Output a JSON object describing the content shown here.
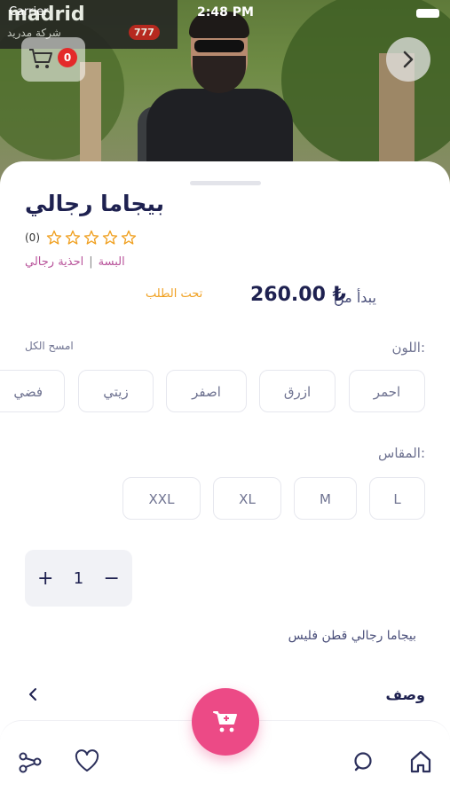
{
  "status_bar": {
    "carrier": "Carrier",
    "time": "2:48 PM"
  },
  "hero": {
    "sign_text": "madrid",
    "sign_sub": "شركة مدريد",
    "badge": "777"
  },
  "header": {
    "cart_count": "0"
  },
  "product": {
    "title": "بيجاما رجالي",
    "rating_count": "(0)",
    "stars": 0,
    "category_1": "البسة",
    "category_2": "احذية رجالي",
    "availability": "تحت الطلب",
    "price_prefix": "يبدأ من",
    "price": "260.00 ₺"
  },
  "color_section": {
    "label": "اللون:",
    "clear_all": "امسح الكل",
    "options": [
      "احمر",
      "ازرق",
      "اصفر",
      "زيتي",
      "فضي"
    ]
  },
  "size_section": {
    "label": "المقاس:",
    "options": [
      "L",
      "M",
      "XL",
      "XXL"
    ]
  },
  "quantity": {
    "plus": "+",
    "value": "1",
    "minus": "−"
  },
  "description_text": "بيجاما رجالي قطن فليس",
  "description_tab": "وصف",
  "colors": {
    "accent": "#ec4a86",
    "title": "#1e2150",
    "category": "#b8539a",
    "availability": "#f0a020",
    "cart_badge": "#e42a2a"
  },
  "icons": {
    "nav_left": [
      "share-icon",
      "heart-icon"
    ],
    "nav_right": [
      "search-icon",
      "home-icon"
    ],
    "fab": "cart-icon"
  }
}
